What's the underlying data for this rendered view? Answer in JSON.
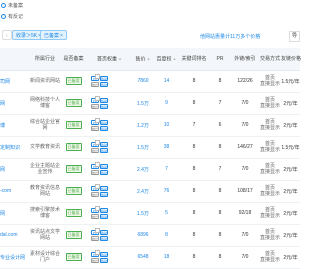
{
  "filters": {
    "radio1": "未备案",
    "radio2": "有反记",
    "chip1": "收录＞5K",
    "chip2": "已备案",
    "notice": "他网站惠量计11万多个价格",
    "export": "导"
  },
  "headers": {
    "site": "",
    "industry": "所属行业",
    "record": "是否备案",
    "weight": "首页权重",
    "price": "售价",
    "weight2": "百度权",
    "kw": "关键词排名",
    "pr": "PR",
    "links": "外链/索引",
    "method": "交易方式",
    "type": "友链",
    "fee": "友链价格"
  },
  "rows": [
    {
      "site": "司网",
      "industry": "新闻资讯网站",
      "record": "已备案",
      "price": "7860",
      "weight": "14",
      "kw": "8",
      "pr": "8",
      "links": "122/26",
      "method": "首页\n直接显示",
      "fee": "1.5元/年"
    },
    {
      "site": "网",
      "industry": "网络科技个人博客",
      "record": "已备案",
      "price": "1.5万",
      "weight": "9",
      "kw": "8",
      "pr": "7",
      "links": "7/0",
      "method": "首页\n直接显示",
      "fee": "2元/年"
    },
    {
      "site": "博",
      "industry": "综合站企业官网",
      "record": "已备案",
      "price": "1.2万",
      "weight": "10",
      "kw": "7",
      "pr": "6",
      "links": "7/0",
      "method": "首页\n直接显示",
      "fee": "2元/年"
    },
    {
      "site": "定制知识",
      "industry": "文学教育资讯",
      "record": "已备案",
      "price": "1.5万",
      "weight": "38",
      "kw": "8",
      "pr": "8",
      "links": "146/27",
      "method": "首页\n直接显示",
      "fee": "1.5元/年"
    },
    {
      "site": "网",
      "industry": "企业主题站企业宣传",
      "record": "已备案",
      "price": "2.4万",
      "weight": "7",
      "kw": "8",
      "pr": "7",
      "links": "7/0",
      "method": "首页\n直接显示",
      "fee": "2元/年"
    },
    {
      "site": "-com",
      "industry": "教育资讯信息网站",
      "record": "已备案",
      "price": "2.4万",
      "weight": "76",
      "kw": "8",
      "pr": "8",
      "links": "108/17",
      "method": "首页\n直接显示",
      "fee": "2元/年"
    },
    {
      "site": "网",
      "industry": "搜索引擎技术博客",
      "record": "已备案",
      "price": "1.5万",
      "weight": "5",
      "kw": "8",
      "pr": "8",
      "links": "92/18",
      "method": "首页\n直接显示",
      "fee": "2元/年"
    },
    {
      "site": "dal.com",
      "industry": "资讯站点文学网站",
      "record": "已备案",
      "price": "6896",
      "weight": "8",
      "kw": "8",
      "pr": "8",
      "links": "7/0",
      "method": "首页\n直接显示",
      "fee": "2元/年"
    },
    {
      "site": "专业设计网",
      "industry": "素材设计综合门户",
      "record": "已备案",
      "price": "6548",
      "weight": "18",
      "kw": "8",
      "pr": "8",
      "links": "7/0",
      "method": "首页\n直接显示",
      "fee": "2元/年"
    }
  ],
  "icons": {
    "pc": "PC",
    "mobile": "移动",
    "stat": "统计"
  },
  "colors": {
    "accent": "#1e88e5",
    "ok": "#4caf50",
    "header_bg": "#f3f6fa"
  }
}
